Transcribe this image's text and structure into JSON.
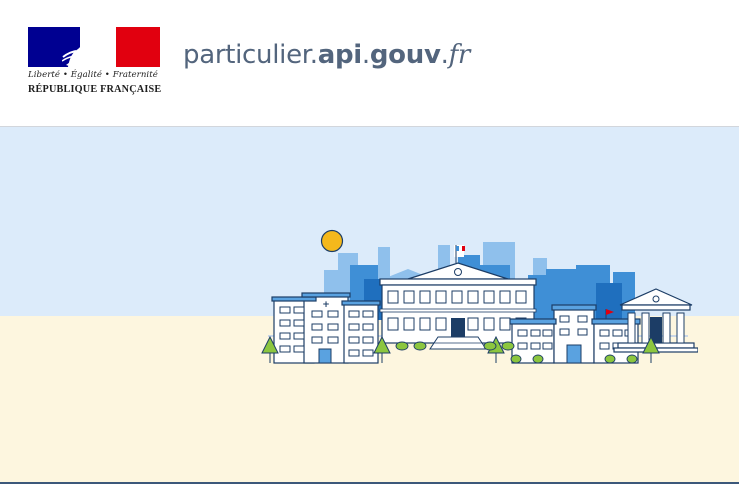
{
  "logo": {
    "motto": "Liberté • Égalité • Fraternité",
    "name": "RÉPUBLIQUE FRANÇAISE",
    "colors": {
      "blue": "#000091",
      "red": "#e1000f"
    }
  },
  "site_title": {
    "part1": "particulier.",
    "part2": "api",
    "part3": ".",
    "part4": "gouv",
    "part5": ".",
    "part6": "fr",
    "color": "#53657d"
  },
  "hero": {
    "sky_color": "#dcebfa",
    "ground_color": "#fdf6df",
    "illustration_icon": "city-buildings-illustration"
  }
}
